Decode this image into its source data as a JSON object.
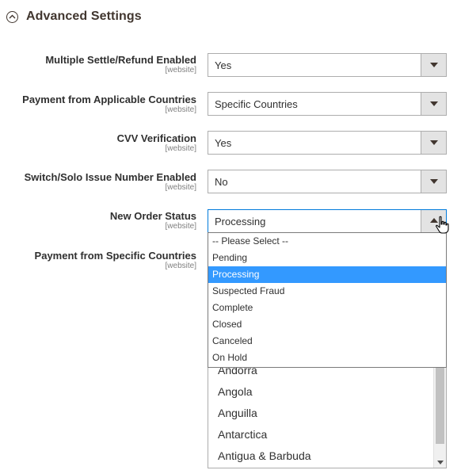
{
  "section": {
    "title": "Advanced Settings"
  },
  "fields": [
    {
      "label": "Multiple Settle/Refund Enabled",
      "scope": "[website]",
      "value": "Yes"
    },
    {
      "label": "Payment from Applicable Countries",
      "scope": "[website]",
      "value": "Specific Countries"
    },
    {
      "label": "CVV Verification",
      "scope": "[website]",
      "value": "Yes"
    },
    {
      "label": "Switch/Solo Issue Number Enabled",
      "scope": "[website]",
      "value": "No"
    },
    {
      "label": "New Order Status",
      "scope": "[website]",
      "value": "Processing"
    },
    {
      "label": "Payment from Specific Countries",
      "scope": "[website]"
    }
  ],
  "order_status_options": [
    "-- Please Select --",
    "Pending",
    "Processing",
    "Suspected Fraud",
    "Complete",
    "Closed",
    "Canceled",
    "On Hold"
  ],
  "order_status_selected": "Processing",
  "countries": [
    "Andorra",
    "Angola",
    "Anguilla",
    "Antarctica",
    "Antigua & Barbuda"
  ],
  "icons": {
    "section_toggle": "collapse-up-icon",
    "cursor": "hand-pointer-icon",
    "dropdown_arrow": "chevron-down-icon"
  },
  "colors": {
    "highlight": "#3399ff",
    "title": "#41362f",
    "focus_border": "#007bdb"
  }
}
